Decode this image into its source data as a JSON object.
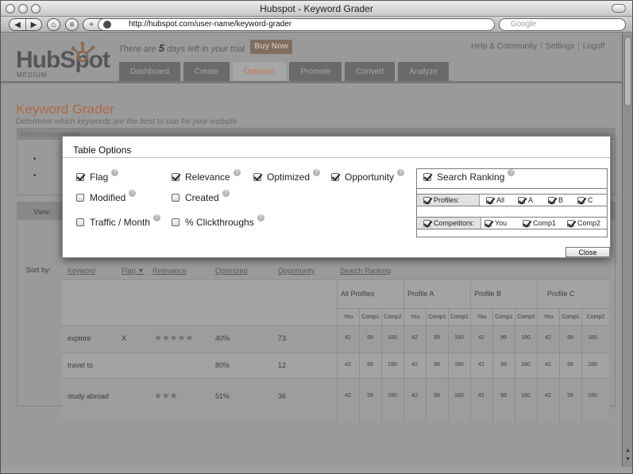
{
  "window": {
    "title": "Hubspot - Keyword Grader"
  },
  "browser": {
    "url": "http://hubspot.com/user-name/keyword-grader",
    "search_placeholder": "Google",
    "icons": [
      "back-arrow-icon",
      "forward-arrow-icon",
      "home-icon",
      "print-icon",
      "add-icon",
      "site-icon"
    ]
  },
  "header": {
    "logo_text": "HubSpot",
    "edition": "MEDIUM",
    "trial_prefix": "There are",
    "trial_days": "5",
    "trial_suffix": "days left in your trial.",
    "buy_now": "Buy Now",
    "links": [
      "Help & Community",
      "Settings",
      "Logoff"
    ]
  },
  "tabs": [
    {
      "label": "Dashboard",
      "active": false
    },
    {
      "label": "Create",
      "active": false
    },
    {
      "label": "Optimize",
      "active": true
    },
    {
      "label": "Promote",
      "active": false
    },
    {
      "label": "Convert",
      "active": false
    },
    {
      "label": "Analyze",
      "active": false
    }
  ],
  "page": {
    "title": "Keyword Grader",
    "subtitle": "Determine which keywords are the best to use for your website",
    "recommendations_label": "Recommendations",
    "view_label": "View:",
    "sort_label": "Sort by:"
  },
  "table": {
    "columns": [
      "Keyword",
      "Flag ▼",
      "Relevance",
      "Optimized",
      "Opportunity",
      "Search Ranking"
    ],
    "profiles": [
      "All Profiles",
      "Profile A",
      "Profile B",
      "Profile C"
    ],
    "sub_columns": [
      "You",
      "Comp1",
      "Comp2"
    ],
    "rows": [
      {
        "keyword": "explore",
        "flag": "X",
        "stars": "★★★★★",
        "optimized": "40%",
        "opportunity": "73",
        "ranks": [
          "42",
          "99",
          "180",
          "42",
          "99",
          "180",
          "42",
          "99",
          "180",
          "42",
          "99",
          "180"
        ]
      },
      {
        "keyword": "travel to",
        "flag": "",
        "stars": "",
        "optimized": "80%",
        "opportunity": "12",
        "ranks": [
          "42",
          "99",
          "180",
          "42",
          "99",
          "180",
          "42",
          "99",
          "180",
          "42",
          "99",
          "180"
        ]
      },
      {
        "keyword": "study abroad",
        "flag": "",
        "stars": "★★★",
        "optimized": "51%",
        "opportunity": "36",
        "ranks": [
          "42",
          "99",
          "180",
          "42",
          "99",
          "180",
          "42",
          "99",
          "180",
          "42",
          "99",
          "180"
        ]
      }
    ]
  },
  "modal": {
    "title": "Table Options",
    "options": {
      "flag": {
        "label": "Flag",
        "checked": true
      },
      "relevance": {
        "label": "Relevance",
        "checked": true
      },
      "optimized": {
        "label": "Optimized",
        "checked": true
      },
      "opportunity": {
        "label": "Opportunity",
        "checked": true
      },
      "modified": {
        "label": "Modified",
        "checked": false
      },
      "created": {
        "label": "Created",
        "checked": false
      },
      "traffic": {
        "label": "Traffic / Month",
        "checked": false
      },
      "clickthroughs": {
        "label": "% Clickthroughs",
        "checked": false
      }
    },
    "ranking": {
      "label": "Search Ranking",
      "checked": true,
      "profiles_label": "Profiles:",
      "profiles": [
        "All",
        "A",
        "B",
        "C"
      ],
      "competitors_label": "Competitors:",
      "competitors": [
        "You",
        "Comp1",
        "Comp2"
      ]
    },
    "help_glyph": "?",
    "close_label": "Close"
  }
}
